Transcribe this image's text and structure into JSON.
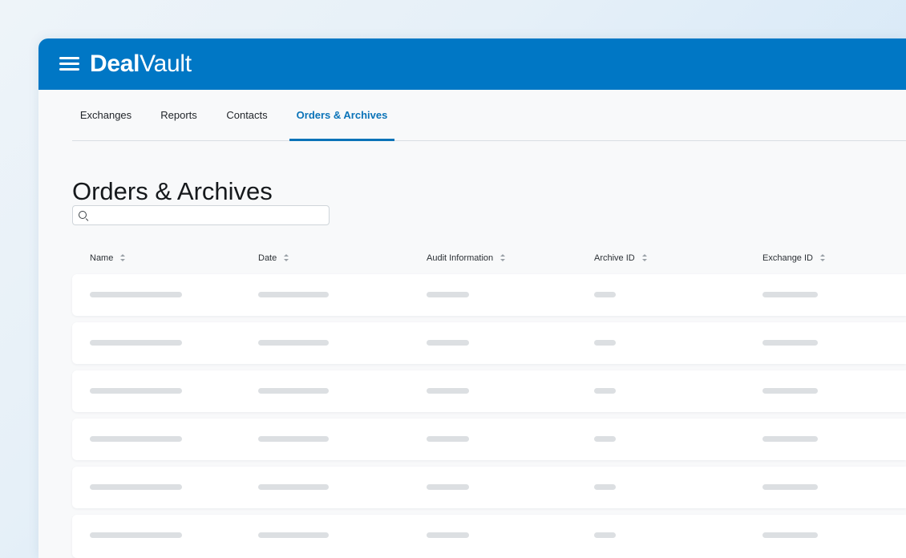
{
  "app": {
    "logo_bold": "Deal",
    "logo_regular": "Vault",
    "header_color": "#0077c5",
    "menu_icon": "hamburger-menu-icon"
  },
  "tabs": [
    {
      "label": "Exchanges",
      "active": false
    },
    {
      "label": "Reports",
      "active": false
    },
    {
      "label": "Contacts",
      "active": false
    },
    {
      "label": "Orders & Archives",
      "active": true
    }
  ],
  "page": {
    "title": "Orders & Archives"
  },
  "search": {
    "placeholder": "",
    "value": "",
    "icon": "search-icon"
  },
  "table": {
    "columns": [
      {
        "label": "Name",
        "sortable": true
      },
      {
        "label": "Date",
        "sortable": true
      },
      {
        "label": "Audit Information",
        "sortable": true
      },
      {
        "label": "Archive ID",
        "sortable": true
      },
      {
        "label": "Exchange ID",
        "sortable": true
      }
    ],
    "loading": true,
    "skeleton_row_count": 6
  },
  "colors": {
    "accent": "#0a73b8",
    "skeleton": "#dcdfe2"
  }
}
